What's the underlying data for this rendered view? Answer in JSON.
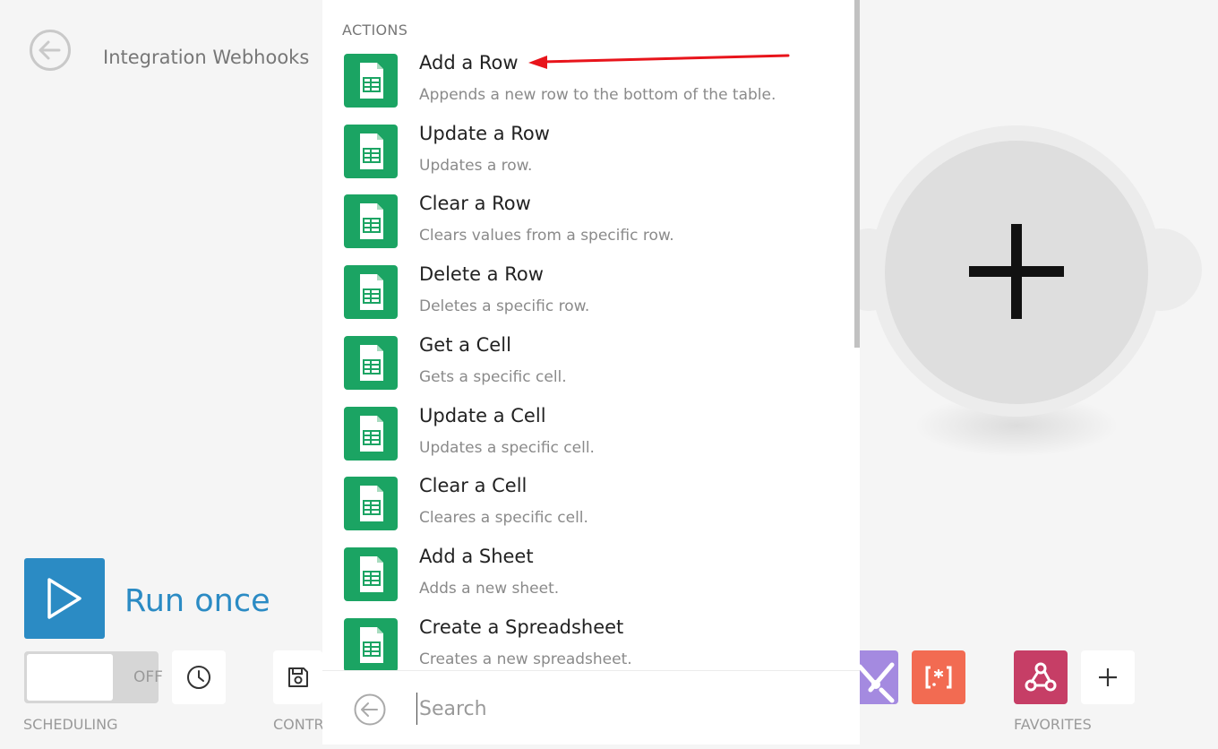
{
  "header": {
    "scenario_title": "Integration Webhooks",
    "back_icon": "arrow-left-circle-icon"
  },
  "run_once": {
    "label": "Run once",
    "icon": "play-icon",
    "color": "#2b8bc4"
  },
  "toolbar": {
    "scheduling_state": "OFF",
    "scheduling_caption": "SCHEDULING",
    "controls_caption": "CONTR",
    "favorites_caption": "FAVORITES",
    "clock_icon": "clock-icon",
    "save_icon": "floppy-disk-icon",
    "add_favorite_icon": "plus-icon",
    "favorites": [
      {
        "app": "tools",
        "icon": "wrench-icon",
        "color": "#a48ae0"
      },
      {
        "app": "text-parser",
        "icon": "bracket-asterisk-icon",
        "color": "#f26b52"
      },
      {
        "app": "webhooks",
        "icon": "webhook-icon",
        "color": "#c63e66"
      }
    ]
  },
  "picker": {
    "heading": "ACTIONS",
    "app_icon": "google-sheets-icon",
    "app_color": "#1ba463",
    "actions": [
      {
        "title": "Add a Row",
        "description": "Appends a new row to the bottom of the table."
      },
      {
        "title": "Update a Row",
        "description": "Updates a row."
      },
      {
        "title": "Clear a Row",
        "description": "Clears values from a specific row."
      },
      {
        "title": "Delete a Row",
        "description": "Deletes a specific row."
      },
      {
        "title": "Get a Cell",
        "description": "Gets a specific cell."
      },
      {
        "title": "Update a Cell",
        "description": "Updates a specific cell."
      },
      {
        "title": "Clear a Cell",
        "description": "Cleares a specific cell."
      },
      {
        "title": "Add a Sheet",
        "description": "Adds a new sheet."
      },
      {
        "title": "Create a Spreadsheet",
        "description": "Creates a new spreadsheet."
      }
    ],
    "search": {
      "placeholder": "Search",
      "value": ""
    }
  },
  "canvas": {
    "add_module_icon": "plus-icon"
  },
  "annotation": {
    "arrow_color": "#e8141b"
  }
}
